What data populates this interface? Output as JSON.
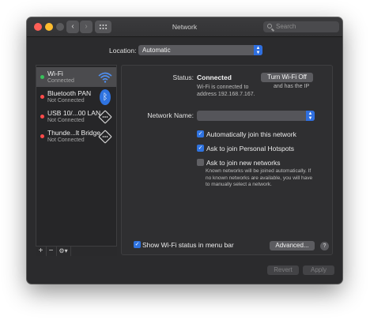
{
  "window": {
    "title": "Network"
  },
  "search": {
    "placeholder": "Search"
  },
  "location": {
    "label": "Location:",
    "value": "Automatic"
  },
  "services": [
    {
      "name": "Wi-Fi",
      "status": "Connected",
      "state": "green",
      "icon": "wifi-icon",
      "selected": true
    },
    {
      "name": "Bluetooth PAN",
      "status": "Not Connected",
      "state": "red",
      "icon": "bluetooth-icon"
    },
    {
      "name": "USB 10/...00 LAN",
      "status": "Not Connected",
      "state": "red",
      "icon": "ethernet-arrows-icon"
    },
    {
      "name": "Thunde...lt Bridge",
      "status": "Not Connected",
      "state": "red",
      "icon": "ethernet-arrows-icon"
    }
  ],
  "sidebar_controls": {
    "add": "+",
    "remove": "−",
    "gear": "⚙▾"
  },
  "panel": {
    "status_label": "Status:",
    "status_value": "Connected",
    "status_detail": "Wi-Fi is connected to address 192.168.7.167.",
    "status_detail_right": "and has the IP",
    "wifi_off_button": "Turn Wi-Fi Off",
    "network_name_label": "Network Name:",
    "network_name_value": "",
    "auto_join": {
      "label": "Automatically join this network",
      "checked": true
    },
    "personal_hotspots": {
      "label": "Ask to join Personal Hotspots",
      "checked": true
    },
    "new_networks": {
      "label": "Ask to join new networks",
      "checked": false
    },
    "new_networks_note": "Known networks will be joined automatically. If no known networks are available, you will have to manually select a network.",
    "show_status": {
      "label": "Show Wi-Fi status in menu bar",
      "checked": true
    },
    "advanced_button": "Advanced...",
    "help": "?"
  },
  "footer": {
    "revert": "Revert",
    "apply": "Apply"
  },
  "colors": {
    "accent": "#2f73e0",
    "connected": "#37c15a",
    "disconnected": "#ff4b4b",
    "window_bg": "#2b2b2d"
  }
}
